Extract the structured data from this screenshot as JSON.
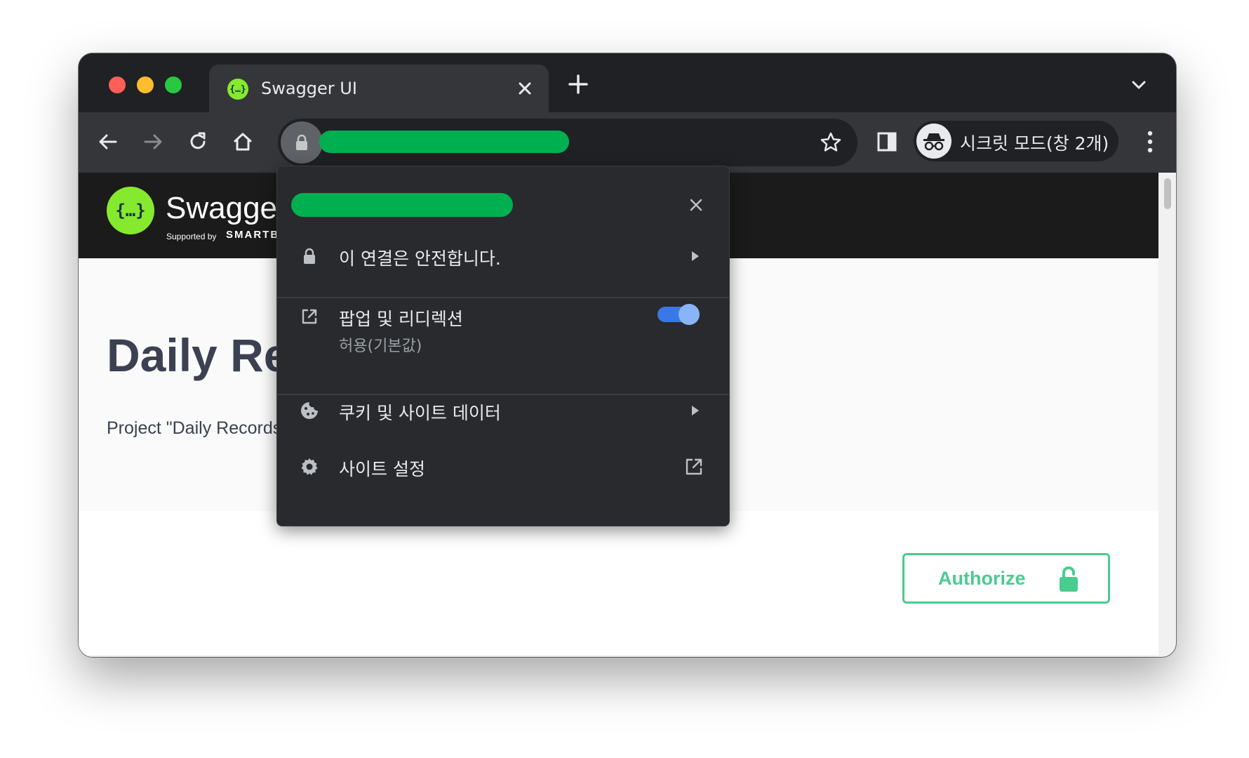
{
  "browser": {
    "tab": {
      "title": "Swagger UI",
      "favicon_text": "{…}"
    },
    "newtab_label": "+",
    "url": "redacted",
    "incognito_label": "시크릿 모드(창 2개)"
  },
  "swagger": {
    "logo_text": "{…}",
    "brand": "Swagger",
    "supported_by": "Supported by",
    "smartbear": "SMARTBEAR",
    "api_title": "Daily Records API",
    "api_description": "Project \"Daily Records\" API",
    "authorize_label": "Authorize"
  },
  "popup": {
    "site": "redacted",
    "connection_label": "이 연결은 안전합니다.",
    "popups_label": "팝업 및 리디렉션",
    "popups_sub": "허용(기본값)",
    "popups_enabled": true,
    "cookies_label": "쿠키 및 사이트 데이터",
    "site_settings_label": "사이트 설정"
  },
  "colors": {
    "redaction": "#00b050",
    "swagger_green": "#85ea2d",
    "authorize_green": "#49cc90",
    "toggle_blue": "#3b78e7"
  }
}
